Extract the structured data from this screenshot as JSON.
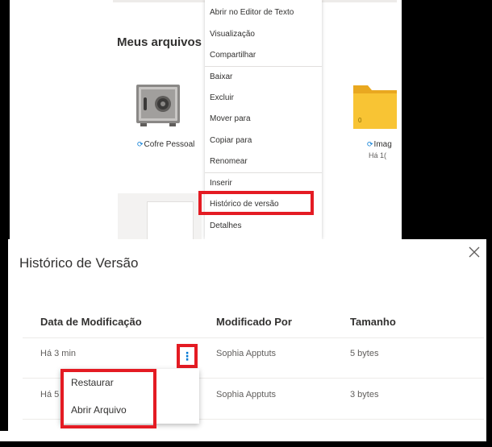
{
  "files_view": {
    "section_title": "Meus arquivos",
    "tiles": [
      {
        "label": "Cofre Pessoal",
        "icon": "safe-icon"
      },
      {
        "label": "Imag",
        "icon": "folder-icon",
        "count": "0",
        "modified": "Há 1("
      }
    ]
  },
  "context_menu": {
    "items": [
      "Abrir no Editor de Texto",
      "Visualização",
      "Compartilhar",
      "Baixar",
      "Excluir",
      "Mover para",
      "Copiar para",
      "Renomear",
      "Inserir",
      "Histórico de versão",
      "Detalhes"
    ],
    "highlighted": "Histórico de versão"
  },
  "version_panel": {
    "title": "Histórico de Versão",
    "columns": [
      "Data de Modificação",
      "Modificado Por",
      "Tamanho"
    ],
    "rows": [
      {
        "date": "Há 3 min",
        "by": "Sophia Apptuts",
        "size": "5 bytes"
      },
      {
        "date": "Há 5",
        "by": "Sophia Apptuts",
        "size": "3 bytes"
      }
    ],
    "more_options_glyph": "⋮",
    "row_menu": [
      "Restaurar",
      "Abrir Arquivo"
    ],
    "close_icon": "close-icon"
  },
  "colors": {
    "highlight": "#e41b23",
    "accent": "#0078d4",
    "folder": "#f8c434"
  }
}
